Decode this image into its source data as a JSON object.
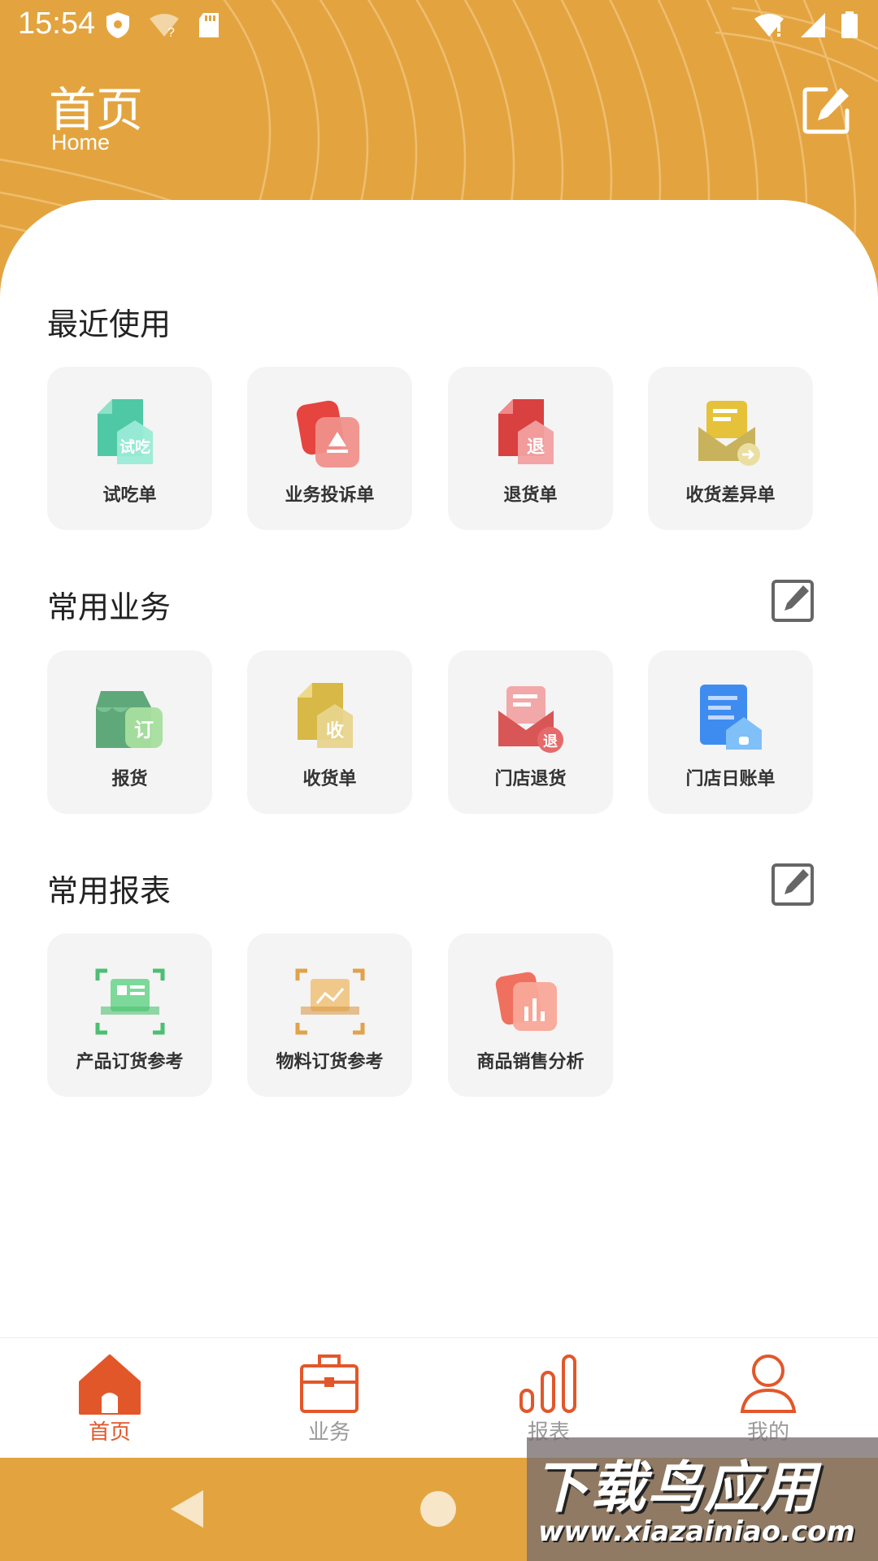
{
  "status_bar": {
    "time": "15:54"
  },
  "header": {
    "title": "首页",
    "subtitle": "Home"
  },
  "sections": {
    "recent": {
      "title": "最近使用",
      "items": [
        {
          "label": "试吃单",
          "icon": "tasting-order-icon",
          "badge": "试吃"
        },
        {
          "label": "业务投诉单",
          "icon": "complaint-order-icon"
        },
        {
          "label": "退货单",
          "icon": "return-order-icon",
          "badge": "退"
        },
        {
          "label": "收货差异单",
          "icon": "receipt-difference-icon"
        }
      ]
    },
    "business": {
      "title": "常用业务",
      "items": [
        {
          "label": "报货",
          "icon": "order-goods-icon",
          "badge": "订"
        },
        {
          "label": "收货单",
          "icon": "receipt-order-icon",
          "badge": "收"
        },
        {
          "label": "门店退货",
          "icon": "store-return-icon",
          "badge": "退"
        },
        {
          "label": "门店日账单",
          "icon": "store-daily-bill-icon"
        }
      ]
    },
    "reports": {
      "title": "常用报表",
      "items": [
        {
          "label": "产品订货参考",
          "icon": "product-order-ref-icon"
        },
        {
          "label": "物料订货参考",
          "icon": "material-order-ref-icon"
        },
        {
          "label": "商品销售分析",
          "icon": "sales-analysis-icon"
        }
      ]
    }
  },
  "bottom_nav": [
    {
      "label": "首页",
      "icon": "home-icon",
      "active": true
    },
    {
      "label": "业务",
      "icon": "briefcase-icon",
      "active": false
    },
    {
      "label": "报表",
      "icon": "bar-chart-icon",
      "active": false
    },
    {
      "label": "我的",
      "icon": "user-icon",
      "active": false
    }
  ],
  "watermark": {
    "title": "下载鸟应用",
    "url": "www.xiazainiao.com"
  },
  "colors": {
    "header": "#E3A43F",
    "accent": "#E2572A",
    "card_bg": "#F4F4F4"
  }
}
